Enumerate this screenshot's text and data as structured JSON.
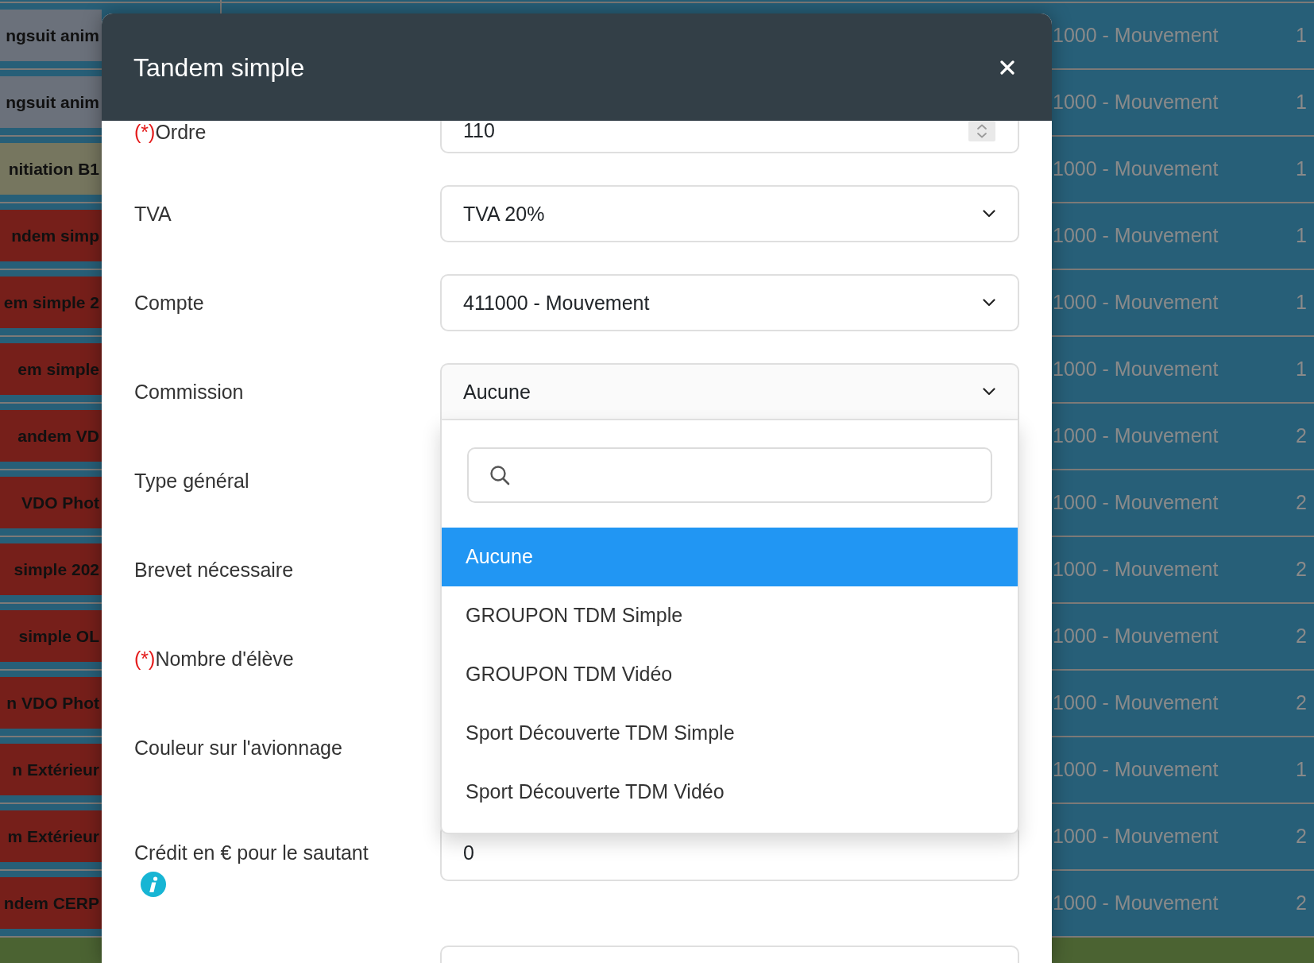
{
  "table": {
    "rows": [
      {
        "kind": "entry",
        "color": "#6b717b",
        "column_1": "ngsuit anim",
        "column_2": "1000 - Mouvement",
        "column_3": "1"
      },
      {
        "kind": "entry",
        "color": "#6b717b",
        "column_1": "ngsuit anim",
        "column_2": "1000 - Mouvement",
        "column_3": "1"
      },
      {
        "kind": "entry",
        "color": "#76765f",
        "column_1": "nitiation B1",
        "column_2": "1000 - Mouvement",
        "column_3": "1"
      },
      {
        "kind": "entry",
        "color": "#761f1a",
        "column_1": "ndem simp",
        "column_2": "1000 - Mouvement",
        "column_3": "1"
      },
      {
        "kind": "entry",
        "color": "#761f1a",
        "column_1": "em simple 2",
        "column_2": "1000 - Mouvement",
        "column_3": "1"
      },
      {
        "kind": "entry",
        "color": "#761f1a",
        "column_1": "em simple",
        "column_2": "1000 - Mouvement",
        "column_3": "1"
      },
      {
        "kind": "entry",
        "color": "#761f1a",
        "column_1": "andem VD",
        "column_2": "1000 - Mouvement",
        "column_3": "2"
      },
      {
        "kind": "entry",
        "color": "#761f1a",
        "column_1": "VDO Phot",
        "column_2": "1000 - Mouvement",
        "column_3": "2"
      },
      {
        "kind": "entry",
        "color": "#761f1a",
        "column_1": "simple 202",
        "column_2": "1000 - Mouvement",
        "column_3": "2"
      },
      {
        "kind": "entry",
        "color": "#761f1a",
        "column_1": "simple OL",
        "column_2": "1000 - Mouvement",
        "column_3": "2"
      },
      {
        "kind": "entry",
        "color": "#761f1a",
        "column_1": "n VDO Phot",
        "column_2": "1000 - Mouvement",
        "column_3": "2"
      },
      {
        "kind": "entry",
        "color": "#761f1a",
        "column_1": "n Extérieur",
        "column_2": "1000 - Mouvement",
        "column_3": "1"
      },
      {
        "kind": "entry",
        "color": "#761f1a",
        "column_1": "m Extérieur",
        "column_2": "1000 - Mouvement",
        "column_3": "2"
      },
      {
        "kind": "entry",
        "color": "#761f1a",
        "column_1": "ndem CERP",
        "column_2": "1000 - Mouvement",
        "column_3": "2"
      },
      {
        "kind": "band",
        "color": "#4b6332"
      }
    ]
  },
  "dialog": {
    "title": "Tandem simple",
    "form": {
      "rows": [
        {
          "required_mark": "(*)",
          "label": "Ordre",
          "kind": "number",
          "value": "110"
        },
        {
          "label": "TVA",
          "kind": "select",
          "value": "TVA 20%",
          "expanded": false
        },
        {
          "label": "Compte",
          "kind": "select",
          "value": "411000 - Mouvement",
          "expanded": false
        },
        {
          "label": "Commission",
          "kind": "select",
          "value": "Aucune",
          "expanded": true,
          "dropdown": {
            "search_field": true,
            "options": [
              {
                "label": "Aucune",
                "selected": true
              },
              {
                "label": "GROUPON TDM Simple",
                "selected": false
              },
              {
                "label": "GROUPON TDM Vidéo",
                "selected": false
              },
              {
                "label": "Sport Découverte TDM Simple",
                "selected": false
              },
              {
                "label": "Sport Découverte TDM Vidéo",
                "selected": false
              }
            ]
          }
        },
        {
          "label": "Type général"
        },
        {
          "label": "Brevet nécessaire"
        },
        {
          "required_mark": "(*)",
          "label": "Nombre d'élève"
        },
        {
          "label": "Couleur sur l'avionnage"
        },
        {
          "label": "Crédit en € pour le sautant",
          "info": true,
          "kind": "text",
          "value": "0"
        },
        {
          "kind": "text"
        }
      ]
    }
  }
}
